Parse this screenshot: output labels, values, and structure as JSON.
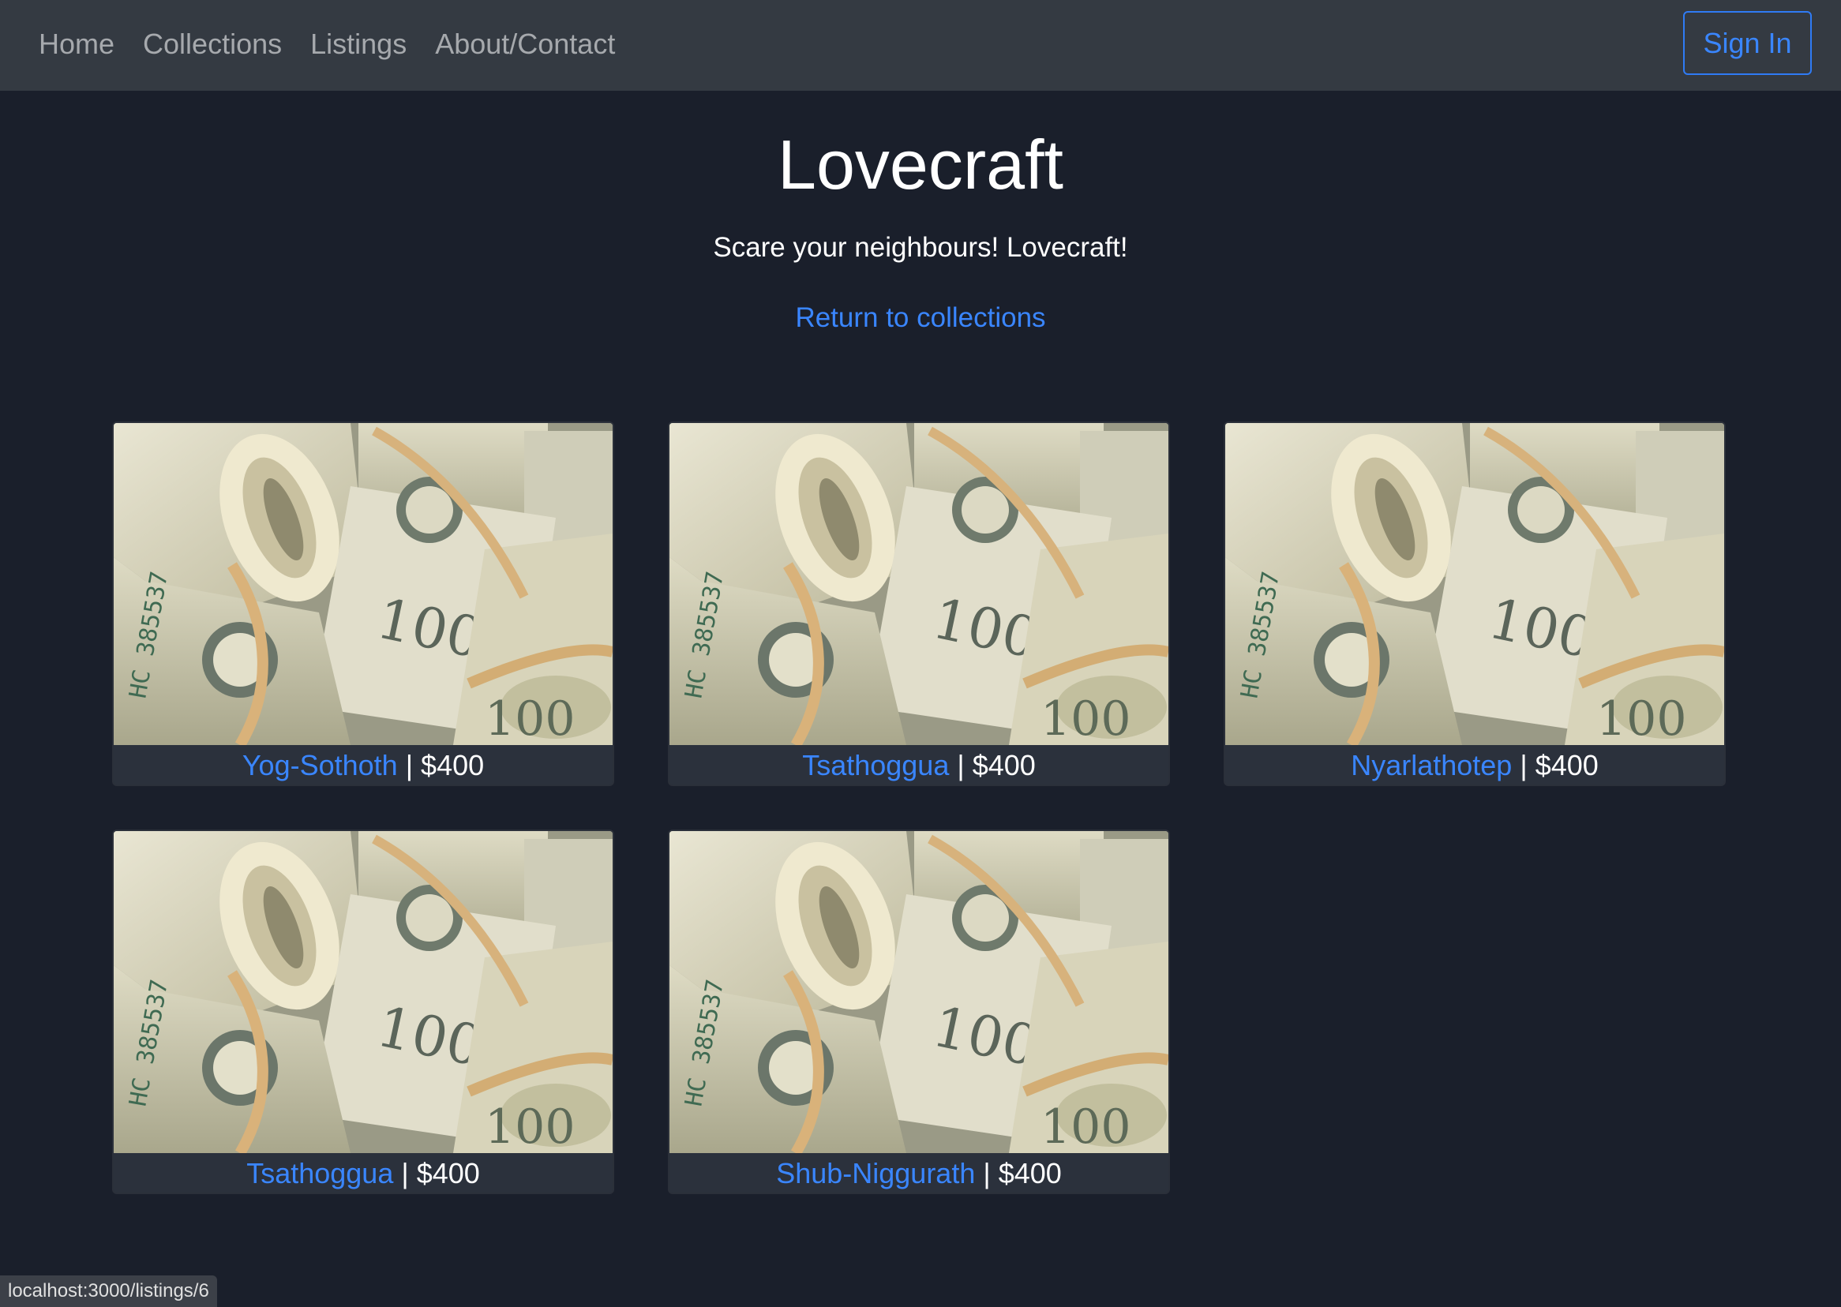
{
  "nav": {
    "links": [
      "Home",
      "Collections",
      "Listings",
      "About/Contact"
    ],
    "signin_label": "Sign In"
  },
  "collection": {
    "title": "Lovecraft",
    "subtitle": "Scare your neighbours! Lovecraft!",
    "return_link": "Return to collections"
  },
  "listings": [
    {
      "name": "Yog-Sothoth",
      "separator": "|",
      "price": "$400"
    },
    {
      "name": "Tsathoggua",
      "separator": "|",
      "price": "$400"
    },
    {
      "name": "Nyarlathotep",
      "separator": "|",
      "price": "$400"
    },
    {
      "name": "Tsathoggua",
      "separator": "|",
      "price": "$400"
    },
    {
      "name": "Shub-Niggurath",
      "separator": "|",
      "price": "$400"
    }
  ],
  "status_bar": {
    "url": "localhost:3000/listings/6"
  },
  "colors": {
    "background": "#1a1f2b",
    "navbar": "#343a42",
    "link": "#3a86ff",
    "card": "#2b313c"
  }
}
